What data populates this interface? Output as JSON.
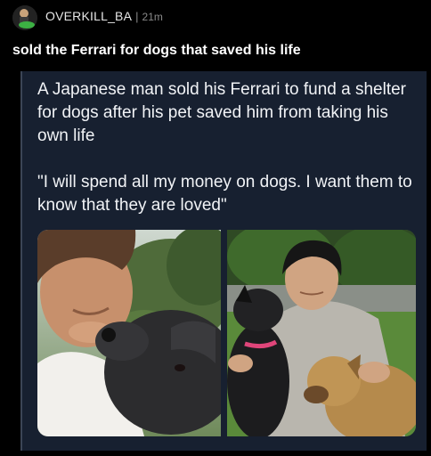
{
  "post": {
    "username": "OVERKILL_BA",
    "separator": "|",
    "time_ago": "21m",
    "title": "sold the Ferrari for dogs that saved his life"
  },
  "tweet": {
    "paragraph_1": "A Japanese man sold his Ferrari to fund a shelter for dogs after his pet saved him from taking his own life",
    "paragraph_2": "\"I will spend all my money on dogs. I want them to know that they are loved\""
  },
  "colors": {
    "background": "#000000",
    "card": "#172030",
    "text": "#f1f3f6",
    "muted": "#8a8a8a"
  }
}
